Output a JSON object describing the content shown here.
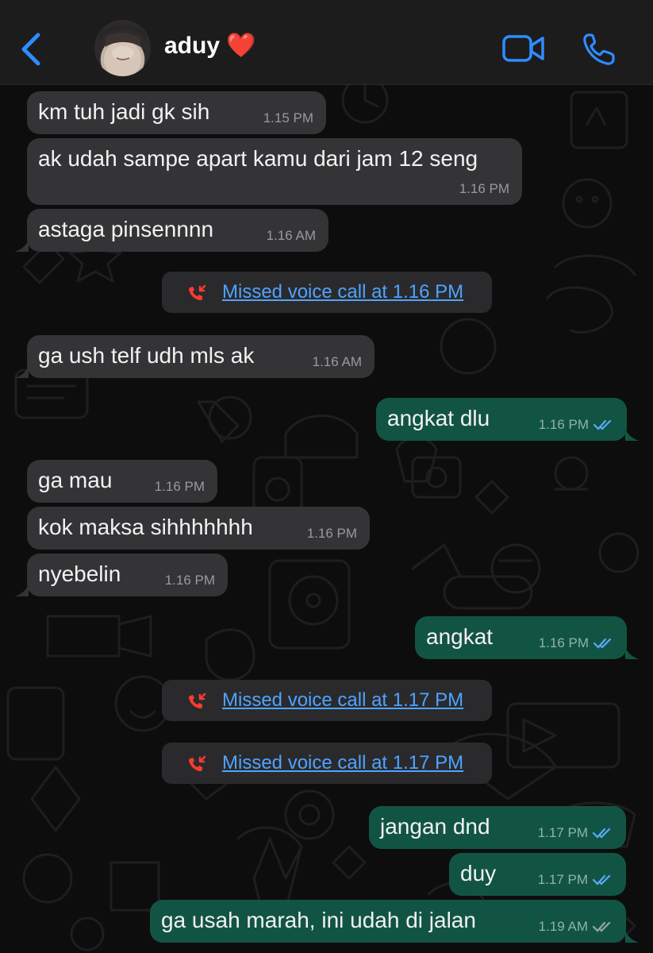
{
  "header": {
    "contact_name": "aduy",
    "contact_emoji": "❤️",
    "back_icon": "chevron-left-icon",
    "video_icon": "video-camera-icon",
    "call_icon": "phone-icon",
    "accent_color": "#2f8cff"
  },
  "messages": [
    {
      "dir": "in",
      "text": "km tuh jadi gk sih",
      "time": "1.15 PM"
    },
    {
      "dir": "in",
      "text": "ak udah sampe apart kamu dari jam 12 seng",
      "time": "1.16 PM"
    },
    {
      "dir": "in",
      "text": "astaga pinsennnn",
      "time": "1.16 AM"
    },
    {
      "dir": "sys",
      "text": "Missed voice call at 1.16 PM"
    },
    {
      "dir": "in",
      "text": "ga ush telf udh mls ak",
      "time": "1.16 AM"
    },
    {
      "dir": "out",
      "text": "angkat dlu",
      "time": "1.16 PM"
    },
    {
      "dir": "in",
      "text": "ga mau",
      "time": "1.16 PM"
    },
    {
      "dir": "in",
      "text": "kok maksa sihhhhhhh",
      "time": "1.16 PM"
    },
    {
      "dir": "in",
      "text": "nyebelin",
      "time": "1.16 PM"
    },
    {
      "dir": "out",
      "text": "angkat",
      "time": "1.16 PM"
    },
    {
      "dir": "sys",
      "text": "Missed voice call at 1.17 PM"
    },
    {
      "dir": "sys",
      "text": "Missed voice call at 1.17 PM"
    },
    {
      "dir": "out",
      "text": "jangan dnd",
      "time": "1.17 PM"
    },
    {
      "dir": "out",
      "text": "duy",
      "time": "1.17 PM"
    },
    {
      "dir": "out",
      "text": "ga usah marah, ini udah di jalan",
      "time": "1.19 AM"
    }
  ],
  "colors": {
    "incoming_bubble": "#343436",
    "outgoing_bubble": "#125443",
    "missed_call_icon": "#ff3b30",
    "link_text": "#4fa3ff",
    "read_ticks": "#5aa9ff"
  }
}
